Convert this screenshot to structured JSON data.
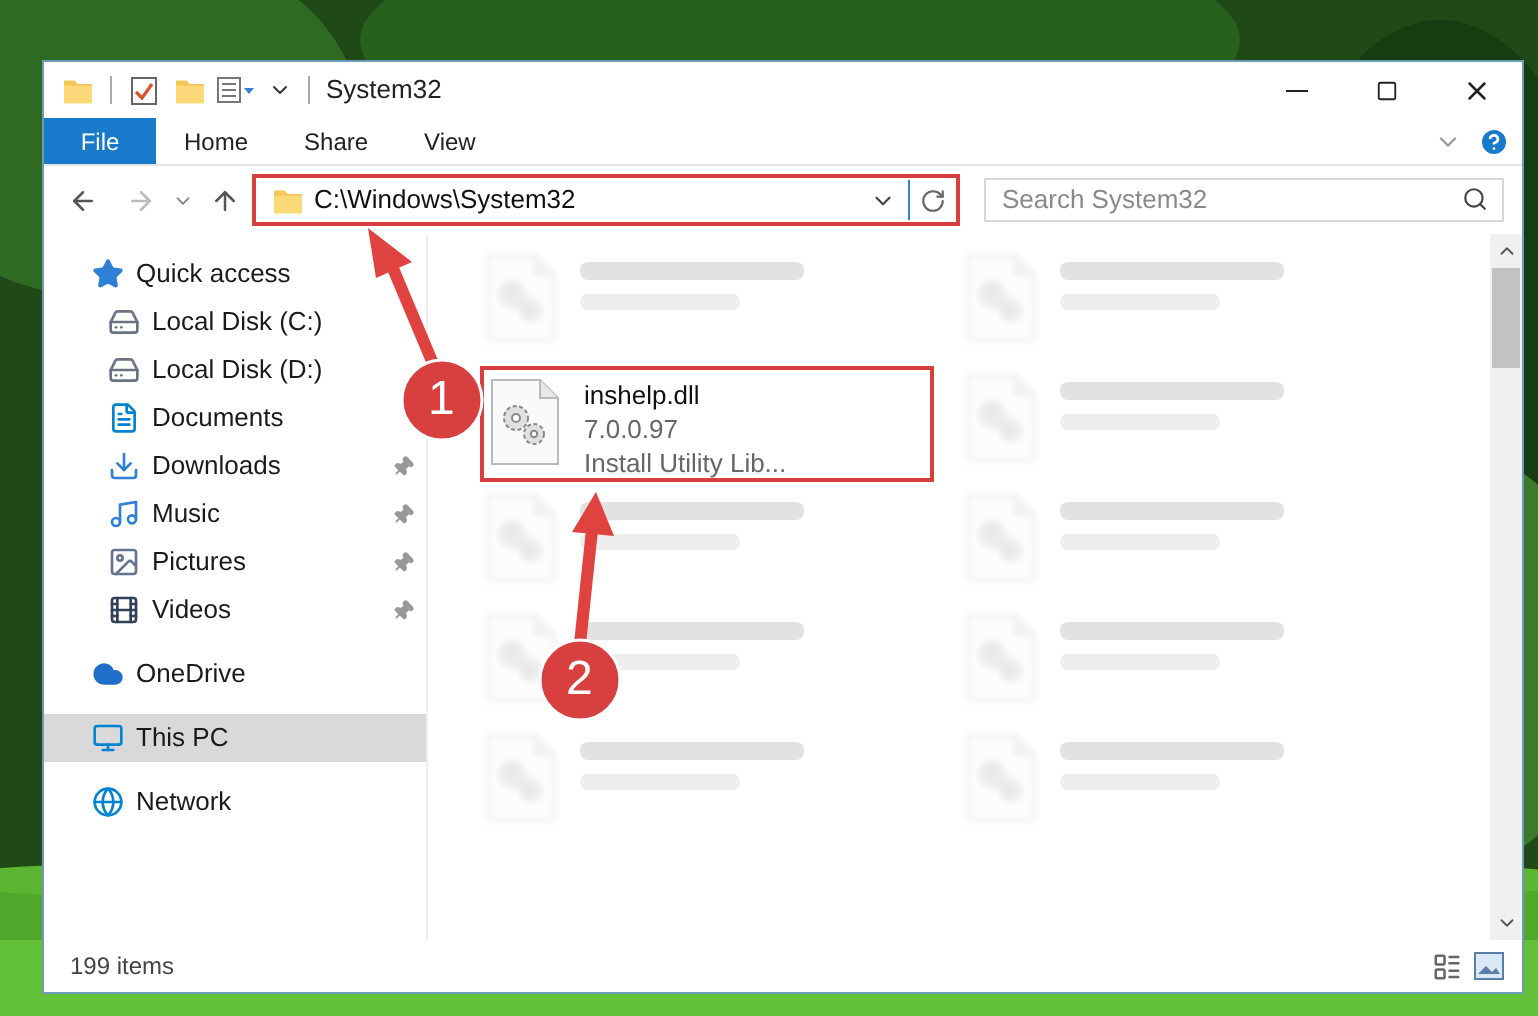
{
  "window": {
    "title": "System32"
  },
  "ribbon_tabs": [
    {
      "label": "File",
      "kind": "file"
    },
    {
      "label": "Home",
      "kind": "tab"
    },
    {
      "label": "Share",
      "kind": "tab"
    },
    {
      "label": "View",
      "kind": "tab"
    }
  ],
  "address_bar": {
    "path": "C:\\Windows\\System32",
    "highlighted": true
  },
  "search": {
    "placeholder": "Search System32"
  },
  "sidebar": {
    "items": [
      {
        "label": "Quick access",
        "selected": false,
        "children": [
          {
            "label": "Local Disk (C:)",
            "pinned": false
          },
          {
            "label": "Local Disk (D:)"
          },
          {
            "label": "Documents"
          },
          {
            "label": "Downloads",
            "pinned": true
          },
          {
            "label": "Music",
            "pinned": true
          },
          {
            "label": "Pictures",
            "pinned": true
          },
          {
            "label": "Videos",
            "pinned": true
          }
        ]
      },
      {
        "label": "OneDrive",
        "selected": false
      },
      {
        "label": "This PC",
        "selected": true
      },
      {
        "label": "Network",
        "selected": false
      }
    ]
  },
  "files": [
    {
      "kind": "blurred"
    },
    {
      "kind": "file",
      "name": "inshelp.dll",
      "lines": [
        "7.0.0.97",
        "Install Utility Lib..."
      ],
      "highlighted": true
    },
    {
      "kind": "blurred"
    },
    {
      "kind": "blurred"
    },
    {
      "kind": "blurred"
    },
    {
      "kind": "blurred"
    },
    {
      "kind": "blurred"
    },
    {
      "kind": "blurred"
    },
    {
      "kind": "blurred"
    },
    {
      "kind": "blurred"
    }
  ],
  "status_bar": {
    "count": "199 items"
  },
  "annotations": [
    {
      "label": "1"
    },
    {
      "label": "2"
    }
  ]
}
